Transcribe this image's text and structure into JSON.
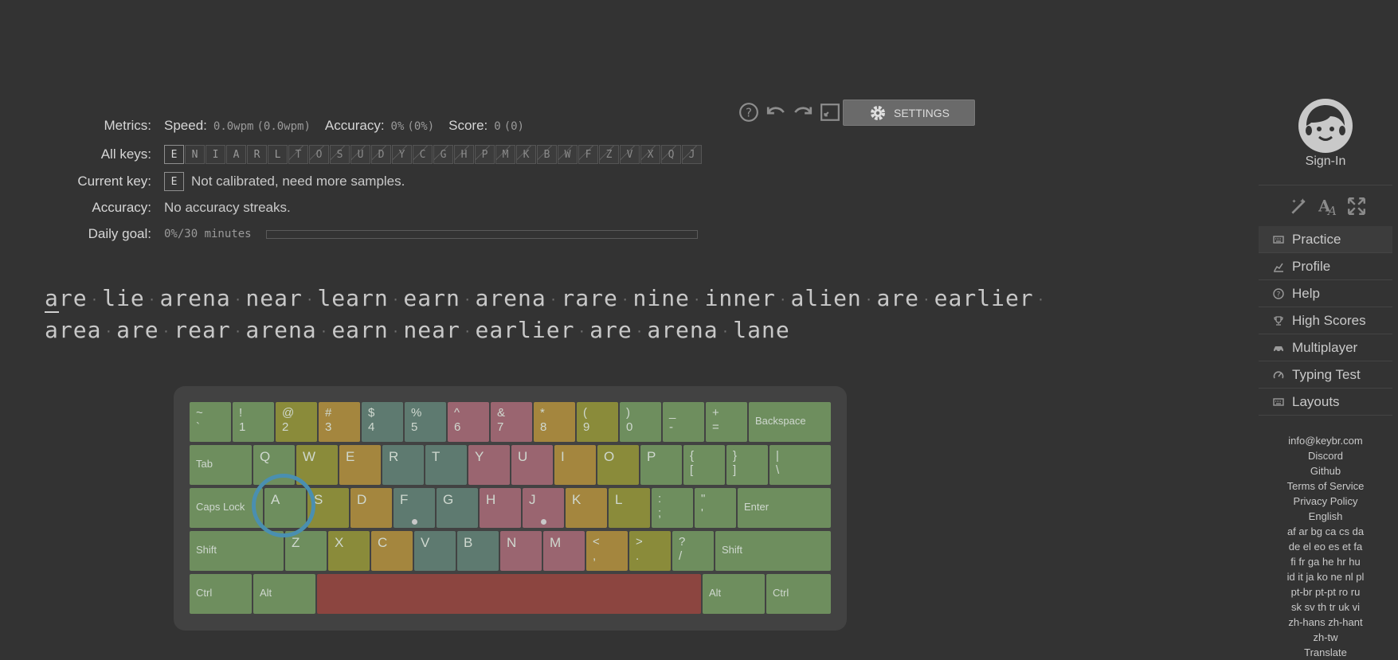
{
  "toolbar": {
    "settings_label": "SETTINGS"
  },
  "metrics": {
    "label": "Metrics:",
    "speed_name": "Speed:",
    "speed_value": "0.0wpm",
    "speed_paren": "(0.0wpm)",
    "accuracy_name": "Accuracy:",
    "accuracy_value": "0%",
    "accuracy_paren": "(0%)",
    "score_name": "Score:",
    "score_value": "0",
    "score_paren": "(0)"
  },
  "all_keys": {
    "label": "All keys:",
    "keys": [
      "E",
      "N",
      "I",
      "A",
      "R",
      "L",
      "T",
      "O",
      "S",
      "U",
      "D",
      "Y",
      "C",
      "G",
      "H",
      "P",
      "M",
      "K",
      "B",
      "W",
      "F",
      "Z",
      "V",
      "X",
      "Q",
      "J"
    ],
    "unlocked_count": 6
  },
  "current_key": {
    "label": "Current key:",
    "key": "E",
    "status": "Not calibrated, need more samples."
  },
  "accuracy_row": {
    "label": "Accuracy:",
    "value": "No accuracy streaks."
  },
  "daily_goal": {
    "label": "Daily goal:",
    "value": "0%/30 minutes",
    "progress_percent": 0
  },
  "practice_text": {
    "line1": [
      "are",
      "lie",
      "arena",
      "near",
      "learn",
      "earn",
      "arena",
      "rare",
      "nine",
      "inner",
      "alien",
      "are",
      "earlier"
    ],
    "line2": [
      "area",
      "are",
      "rear",
      "arena",
      "earn",
      "near",
      "earlier",
      "are",
      "arena",
      "lane"
    ]
  },
  "keyboard": {
    "row1": [
      {
        "top": "~",
        "bot": "`",
        "color": "g"
      },
      {
        "top": "!",
        "bot": "1",
        "color": "g"
      },
      {
        "top": "@",
        "bot": "2",
        "color": "y"
      },
      {
        "top": "#",
        "bot": "3",
        "color": "o"
      },
      {
        "top": "$",
        "bot": "4",
        "color": "t"
      },
      {
        "top": "%",
        "bot": "5",
        "color": "t"
      },
      {
        "top": "^",
        "bot": "6",
        "color": "p"
      },
      {
        "top": "&",
        "bot": "7",
        "color": "p"
      },
      {
        "top": "*",
        "bot": "8",
        "color": "o"
      },
      {
        "top": "(",
        "bot": "9",
        "color": "y"
      },
      {
        "top": ")",
        "bot": "0",
        "color": "g"
      },
      {
        "top": "_",
        "bot": "-",
        "color": "g"
      },
      {
        "top": "+",
        "bot": "=",
        "color": "g"
      }
    ],
    "backspace": "Backspace",
    "tab": "Tab",
    "row2": [
      {
        "l": "Q",
        "color": "g"
      },
      {
        "l": "W",
        "color": "y"
      },
      {
        "l": "E",
        "color": "o"
      },
      {
        "l": "R",
        "color": "t"
      },
      {
        "l": "T",
        "color": "t"
      },
      {
        "l": "Y",
        "color": "p"
      },
      {
        "l": "U",
        "color": "p"
      },
      {
        "l": "I",
        "color": "o"
      },
      {
        "l": "O",
        "color": "y"
      },
      {
        "l": "P",
        "color": "g"
      }
    ],
    "row2_sym": [
      {
        "top": "{",
        "bot": "[",
        "color": "g"
      },
      {
        "top": "}",
        "bot": "]",
        "color": "g"
      },
      {
        "top": "|",
        "bot": "\\",
        "color": "g"
      }
    ],
    "caps": "Caps Lock",
    "row3": [
      {
        "l": "A",
        "color": "g"
      },
      {
        "l": "S",
        "color": "y"
      },
      {
        "l": "D",
        "color": "o"
      },
      {
        "l": "F",
        "color": "t"
      },
      {
        "l": "G",
        "color": "t"
      },
      {
        "l": "H",
        "color": "p"
      },
      {
        "l": "J",
        "color": "p"
      },
      {
        "l": "K",
        "color": "o"
      },
      {
        "l": "L",
        "color": "y"
      }
    ],
    "row3_sym": [
      {
        "top": ":",
        "bot": ";",
        "color": "g"
      },
      {
        "top": "\"",
        "bot": "'",
        "color": "g"
      }
    ],
    "enter": "Enter",
    "shift": "Shift",
    "row4": [
      {
        "l": "Z",
        "color": "g"
      },
      {
        "l": "X",
        "color": "y"
      },
      {
        "l": "C",
        "color": "o"
      },
      {
        "l": "V",
        "color": "t"
      },
      {
        "l": "B",
        "color": "t"
      },
      {
        "l": "N",
        "color": "p"
      },
      {
        "l": "M",
        "color": "p"
      }
    ],
    "row4_sym": [
      {
        "top": "<",
        "bot": ",",
        "color": "o"
      },
      {
        "top": ">",
        "bot": ".",
        "color": "y"
      },
      {
        "top": "?",
        "bot": "/",
        "color": "g"
      }
    ],
    "ctrl": "Ctrl",
    "alt": "Alt"
  },
  "sidebar": {
    "signin": "Sign-In",
    "nav": [
      {
        "label": "Practice",
        "icon": "keyboard-icon"
      },
      {
        "label": "Profile",
        "icon": "chart-icon"
      },
      {
        "label": "Help",
        "icon": "help-icon"
      },
      {
        "label": "High Scores",
        "icon": "trophy-icon"
      },
      {
        "label": "Multiplayer",
        "icon": "car-icon"
      },
      {
        "label": "Typing Test",
        "icon": "gauge-icon"
      },
      {
        "label": "Layouts",
        "icon": "keyboard-icon"
      }
    ],
    "links": [
      "info@keybr.com",
      "Discord",
      "Github",
      "Terms of Service",
      "Privacy Policy",
      "English",
      "af ar bg ca cs da",
      "de el eo es et fa",
      "fi fr ga he hr hu",
      "id it ja ko ne nl pl",
      "pt-br pt-pt ro ru",
      "sk sv th tr uk vi",
      "zh-hans zh-hant",
      "zh-tw",
      "Translate"
    ]
  }
}
